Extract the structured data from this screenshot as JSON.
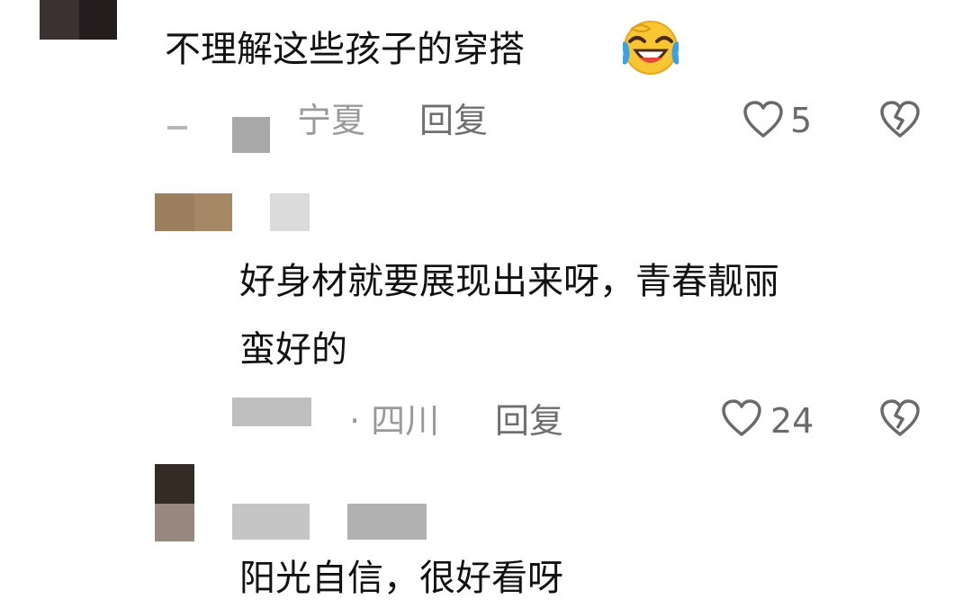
{
  "comments": [
    {
      "text": "不理解这些孩子的穿搭",
      "location": "宁夏",
      "reply_label": "回复",
      "likes": "5",
      "emoji_icon": "laughing-crying-face-icon"
    },
    {
      "text_line1": "好身材就要展现出来呀，青春靓丽",
      "text_line2": "蛮好的",
      "location": "· 四川",
      "reply_label": "回复",
      "likes": "24"
    },
    {
      "text": "阳光自信，很好看呀"
    }
  ],
  "colors": {
    "text": "#111111",
    "meta": "#9a9a9a",
    "reply": "#6f6f6f",
    "icon": "#6a6a6a",
    "background": "#ffffff"
  }
}
